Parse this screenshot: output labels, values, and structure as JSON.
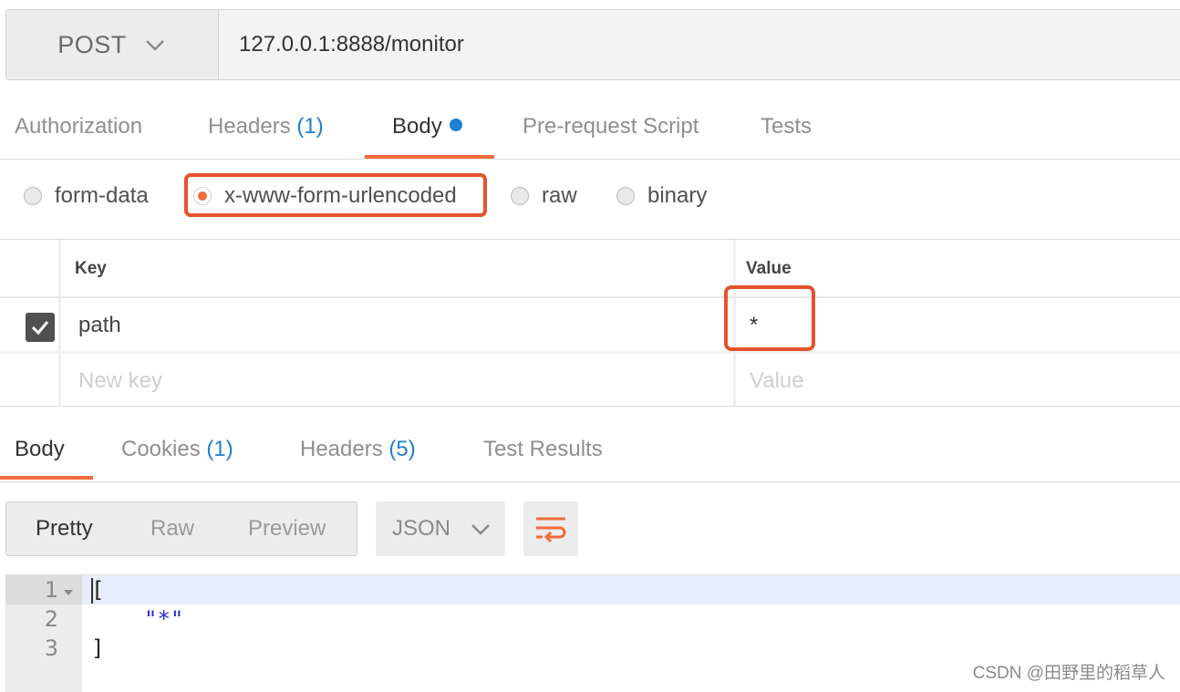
{
  "request": {
    "method": "POST",
    "url": "127.0.0.1:8888/monitor"
  },
  "request_tabs": [
    {
      "label": "Authorization",
      "count": ""
    },
    {
      "label": "Headers",
      "count": "(1)"
    },
    {
      "label": "Body",
      "count": "",
      "active": true
    },
    {
      "label": "Pre-request Script",
      "count": ""
    },
    {
      "label": "Tests",
      "count": ""
    }
  ],
  "body_types": {
    "form_data": "form-data",
    "urlencoded": "x-www-form-urlencoded",
    "raw": "raw",
    "binary": "binary",
    "selected": "x-www-form-urlencoded"
  },
  "params_table": {
    "key_header": "Key",
    "value_header": "Value",
    "rows": [
      {
        "key": "path",
        "value": "*",
        "checked": true
      }
    ],
    "new_key_placeholder": "New key",
    "new_value_placeholder": "Value"
  },
  "response_tabs": [
    {
      "label": "Body",
      "count": "",
      "active": true
    },
    {
      "label": "Cookies",
      "count": "(1)"
    },
    {
      "label": "Headers",
      "count": "(5)"
    },
    {
      "label": "Test Results",
      "count": ""
    }
  ],
  "view_modes": [
    "Pretty",
    "Raw",
    "Preview"
  ],
  "active_view_mode": "Pretty",
  "format": "JSON",
  "editor": {
    "line_numbers": [
      "1",
      "2",
      "3"
    ],
    "lines": [
      "[",
      "\"*\"",
      "]"
    ]
  },
  "watermark": "CSDN @田野里的稻草人",
  "colors": {
    "accent": "#f26b3a",
    "link": "#1f7fd0",
    "highlight_box": "#e5522a"
  }
}
